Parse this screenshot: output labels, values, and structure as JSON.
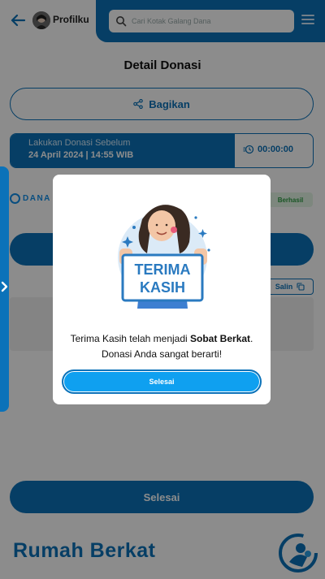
{
  "header": {
    "profile_label": "Profilku",
    "search_placeholder": "Cari Kotak Galang Dana"
  },
  "page": {
    "title": "Detail Donasi",
    "share_label": "Bagikan",
    "deadline_label": "Lakukan Donasi Sebelum",
    "deadline_date": "24 April 2024 | 14:55 WIB",
    "countdown": "00:00:00",
    "payment_method": "DANA",
    "status": "Berhasil",
    "copy_label": "Salin",
    "bottom_button": "Selesai",
    "footer_brand": "Rumah Berkat"
  },
  "modal": {
    "illustration_line1": "TERIMA",
    "illustration_line2": "KASIH",
    "text_before": "Terima Kasih telah menjadi ",
    "text_bold": "Sobat Berkat",
    "text_after": ".",
    "text_line2": "Donasi Anda sangat berarti!",
    "button_label": "Selesai"
  },
  "colors": {
    "primary": "#0b72b9",
    "accent": "#0fa0f0",
    "success": "#2e9b43"
  },
  "icons": [
    "back-arrow-icon",
    "search-icon",
    "menu-icon",
    "share-icon",
    "clock-icon",
    "copy-icon",
    "chevron-right-icon"
  ]
}
